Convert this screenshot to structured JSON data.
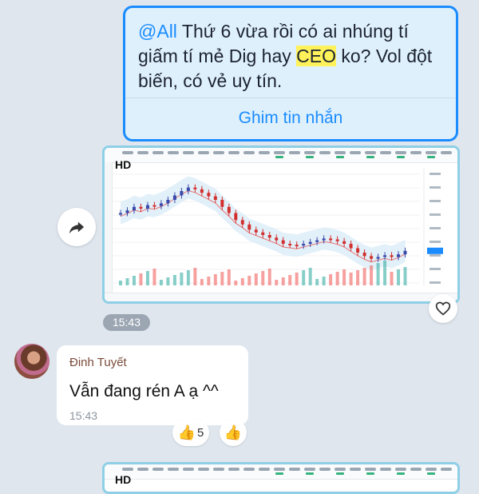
{
  "pinned_message": {
    "mention": "@All",
    "text_before": " Thứ 6 vừa rồi có ai nhúng tí giấm tí mẻ Dig hay ",
    "highlight": "CEO",
    "text_after": " ko? Vol đột biến, có vẻ uy tín.",
    "action_label": "Ghim tin nhắn"
  },
  "chart_image": {
    "label": "HD",
    "accent_color": "#1a8cff"
  },
  "shared_time": "15:43",
  "reply": {
    "sender": "Đinh Tuyết",
    "text": "Vẫn đang rén A ạ ^^",
    "time": "15:43"
  },
  "reactions": {
    "count": "5",
    "icon": "thumbs-up-icon"
  },
  "second_chart": {
    "label": "HD"
  },
  "colors": {
    "background": "#dfe6ee",
    "accent": "#1a8cff",
    "candle_up": "#26a69a",
    "candle_down": "#ef5350",
    "band": "#cfe6f5"
  }
}
